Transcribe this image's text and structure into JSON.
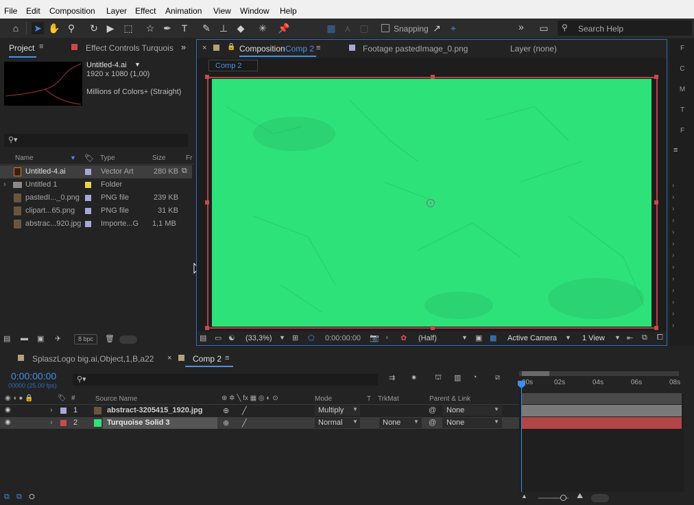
{
  "menu": {
    "items": [
      "File",
      "Edit",
      "Composition",
      "Layer",
      "Effect",
      "Animation",
      "View",
      "Window",
      "Help"
    ]
  },
  "toolbar": {
    "snapping_label": "Snapping",
    "search_placeholder": "Search Help",
    "more": "»"
  },
  "project_panel": {
    "tab_project": "Project",
    "tab_effect_controls": "Effect Controls Turquois",
    "preview_name": "Untitled-4.ai",
    "preview_dims": "1920 x 1080 (1,00)",
    "preview_colors": "Millions of Colors+ (Straight)",
    "search_placeholder": "",
    "columns": {
      "name": "Name",
      "type": "Type",
      "size": "Size",
      "fr": "Fr"
    },
    "items": [
      {
        "name": "Untitled-4.ai",
        "type": "Vector Art",
        "size": "280 KB",
        "label_color": "#a8a8d8",
        "icon": "ai-file-icon"
      },
      {
        "name": "Untitled 1",
        "type": "Folder",
        "size": "",
        "label_color": "#e5d44a",
        "icon": "folder-icon"
      },
      {
        "name": "pastedI..._0.png",
        "type": "PNG file",
        "size": "239 KB",
        "label_color": "#a8a8d8",
        "icon": "png-file-icon"
      },
      {
        "name": "clipart...65.png",
        "type": "PNG file",
        "size": "31 KB",
        "label_color": "#a8a8d8",
        "icon": "png-file-icon"
      },
      {
        "name": "abstrac...920.jpg",
        "type": "Importe...G",
        "size": "1,1 MB",
        "label_color": "#a8a8d8",
        "icon": "jpg-file-icon"
      }
    ],
    "bpc": "8 bpc"
  },
  "viewer": {
    "tab_composition": "Composition",
    "comp_name": "Comp 2",
    "tab_footage": "Footage  pastedImage_0.png",
    "tab_layer": "Layer (none)",
    "breadcrumb": "Comp 2",
    "zoom": "(33,3%)",
    "timecode": "0:00:00:00",
    "resolution": "(Half)",
    "camera": "Active Camera",
    "views": "1 View",
    "canvas_color": "#2ee27a"
  },
  "timeline": {
    "tab_other": "SplaszLogo big.ai,Object,1,B,a22",
    "tab_active": "Comp 2",
    "timecode": "0:00:00:00",
    "fps": "00000 (25.00 fps)",
    "columns": {
      "source": "Source Name",
      "mode": "Mode",
      "t": "T",
      "trkmat": "TrkMat",
      "parent": "Parent & Link"
    },
    "ruler": [
      "00s",
      "02s",
      "04s",
      "06s",
      "08s"
    ],
    "layers": [
      {
        "num": "1",
        "name": "abstract-3205415_1920.jpg",
        "mode": "Multiply",
        "trkmat": "",
        "parent": "None",
        "label_color": "#a8a8d8",
        "bar_color": "#7a7a7a"
      },
      {
        "num": "2",
        "name": "Turquoise Solid 3",
        "mode": "Normal",
        "trkmat": "None",
        "parent": "None",
        "label_color": "#c94a4a",
        "bar_color": "#b24545"
      }
    ]
  },
  "right_panel": {
    "letters": [
      "F",
      "C",
      "M",
      "T",
      "F"
    ]
  }
}
